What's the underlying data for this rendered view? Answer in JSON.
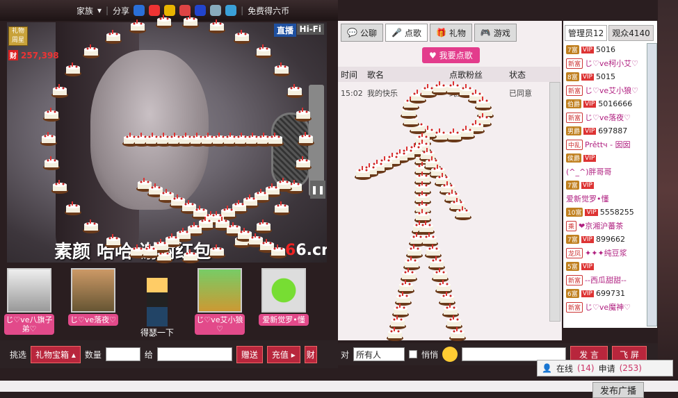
{
  "topbar": {
    "family": "家族",
    "share": "分享",
    "free_coins": "免费得六币"
  },
  "video": {
    "live": "直播",
    "hifi": "Hi-Fi",
    "gift_star": "礼物周星",
    "heat": "257,398",
    "caption": "素颜  哈哈  谢谢红包",
    "logo": "6.cn"
  },
  "fans": [
    {
      "name": "じ♡ve八旗子弟♡"
    },
    {
      "name": "じ♡ve落夜♡"
    },
    {
      "name": "得瑟一下"
    },
    {
      "name": "じ♡ve艾小狼♡"
    },
    {
      "name": "爱新觉罗•懂"
    }
  ],
  "giftbar": {
    "pick": "挑选",
    "treasure": "礼物宝箱",
    "qty": "数量",
    "to": "给",
    "give": "赠送",
    "recharge": "充值",
    "cai": "财"
  },
  "mid": {
    "tabs": [
      {
        "label": "公聊",
        "icon": "chat-icon"
      },
      {
        "label": "点歌",
        "icon": "mic-icon"
      },
      {
        "label": "礼物",
        "icon": "gift-icon"
      },
      {
        "label": "游戏",
        "icon": "gamepad-icon"
      }
    ],
    "request_song": "我要点歌",
    "headers": [
      "时间",
      "歌名",
      "点歌粉丝",
      "状态"
    ],
    "row": {
      "time": "15:02",
      "song": "我的快乐",
      "fan": "纯豆浆",
      "status": "已同意"
    }
  },
  "chatbar": {
    "to": "对",
    "target": "所有人",
    "whisper": "悄悄",
    "send": "发 言",
    "fly": "飞 屏"
  },
  "right": {
    "tab_admin": "管理员12",
    "tab_audience": "观众4140",
    "users": [
      {
        "lvl": "7富",
        "vip": "VIP",
        "name": "5016"
      },
      {
        "lvl": "新富",
        "vip": "",
        "name": "じ♡ve柯小艾♡"
      },
      {
        "lvl": "8富",
        "vip": "VIP",
        "name": "5015"
      },
      {
        "lvl": "新富",
        "vip": "",
        "name": "じ♡ve艾小狼♡"
      },
      {
        "lvl": "伯爵",
        "vip": "VIP",
        "name": "5016666"
      },
      {
        "lvl": "新富",
        "vip": "",
        "name": "じ♡ve落夜♡"
      },
      {
        "lvl": "男爵",
        "vip": "VIP",
        "name": "697887"
      },
      {
        "lvl": "中乱",
        "vip": "",
        "name": "Prěttч - 囡囡"
      },
      {
        "lvl": "侯爵",
        "vip": "VIP",
        "name": ""
      },
      {
        "lvl": "",
        "vip": "",
        "name": "(^_^)胖哥哥"
      },
      {
        "lvl": "7富",
        "vip": "VIP",
        "name": ""
      },
      {
        "lvl": "",
        "vip": "",
        "name": "爱新觉罗•懂"
      },
      {
        "lvl": "10富",
        "vip": "VIP",
        "name": "5558255"
      },
      {
        "lvl": "乘",
        "vip": "",
        "name": "❤京湘沪蕃茶"
      },
      {
        "lvl": "7富",
        "vip": "VIP",
        "name": "899662"
      },
      {
        "lvl": "龙凤",
        "vip": "",
        "name": "✦✦✦纯豆浆"
      },
      {
        "lvl": "5富",
        "vip": "VIP",
        "name": ""
      },
      {
        "lvl": "新富",
        "vip": "",
        "name": "--西瓜甜甜--"
      },
      {
        "lvl": "6富",
        "vip": "VIP",
        "name": "699731"
      },
      {
        "lvl": "新富",
        "vip": "",
        "name": "じ♡ve魔神♡"
      }
    ]
  },
  "online": {
    "label": "在线",
    "count": "(14)",
    "apply_label": "申请",
    "apply_count": "(253)"
  },
  "bottom": {
    "send_screen": "发布广播"
  }
}
